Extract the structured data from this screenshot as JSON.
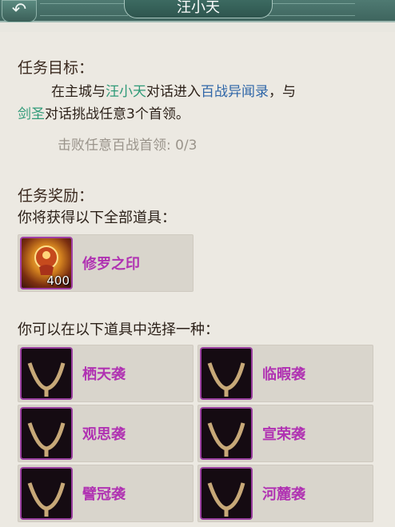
{
  "header": {
    "title": "汪小天",
    "back_icon": "↶"
  },
  "task": {
    "goal_heading": "任务目标：",
    "desc_line1_pre": "在主城与",
    "desc_npc1": "汪小天",
    "desc_line1_mid": "对话进入",
    "desc_dungeon": "百战异闻录",
    "desc_line1_post": "，与",
    "desc_npc2": "剑圣",
    "desc_line2_post": "对话挑战任意3个首领。",
    "progress": "击败任意百战首领: 0/3"
  },
  "rewards": {
    "heading": "任务奖励：",
    "fixed_label": "你将获得以下全部道具：",
    "fixed_item": {
      "name": "修罗之印",
      "count": "400"
    },
    "choice_label": "你可以在以下道具中选择一种：",
    "choices": [
      {
        "name": "栖天袭"
      },
      {
        "name": "临暇袭"
      },
      {
        "name": "观思袭"
      },
      {
        "name": "宣荣袭"
      },
      {
        "name": "譬冠袭"
      },
      {
        "name": "河麓袭"
      }
    ]
  },
  "colors": {
    "item_name": "#b032b2",
    "npc": "#2f9a78",
    "dungeon": "#2f66a8"
  }
}
